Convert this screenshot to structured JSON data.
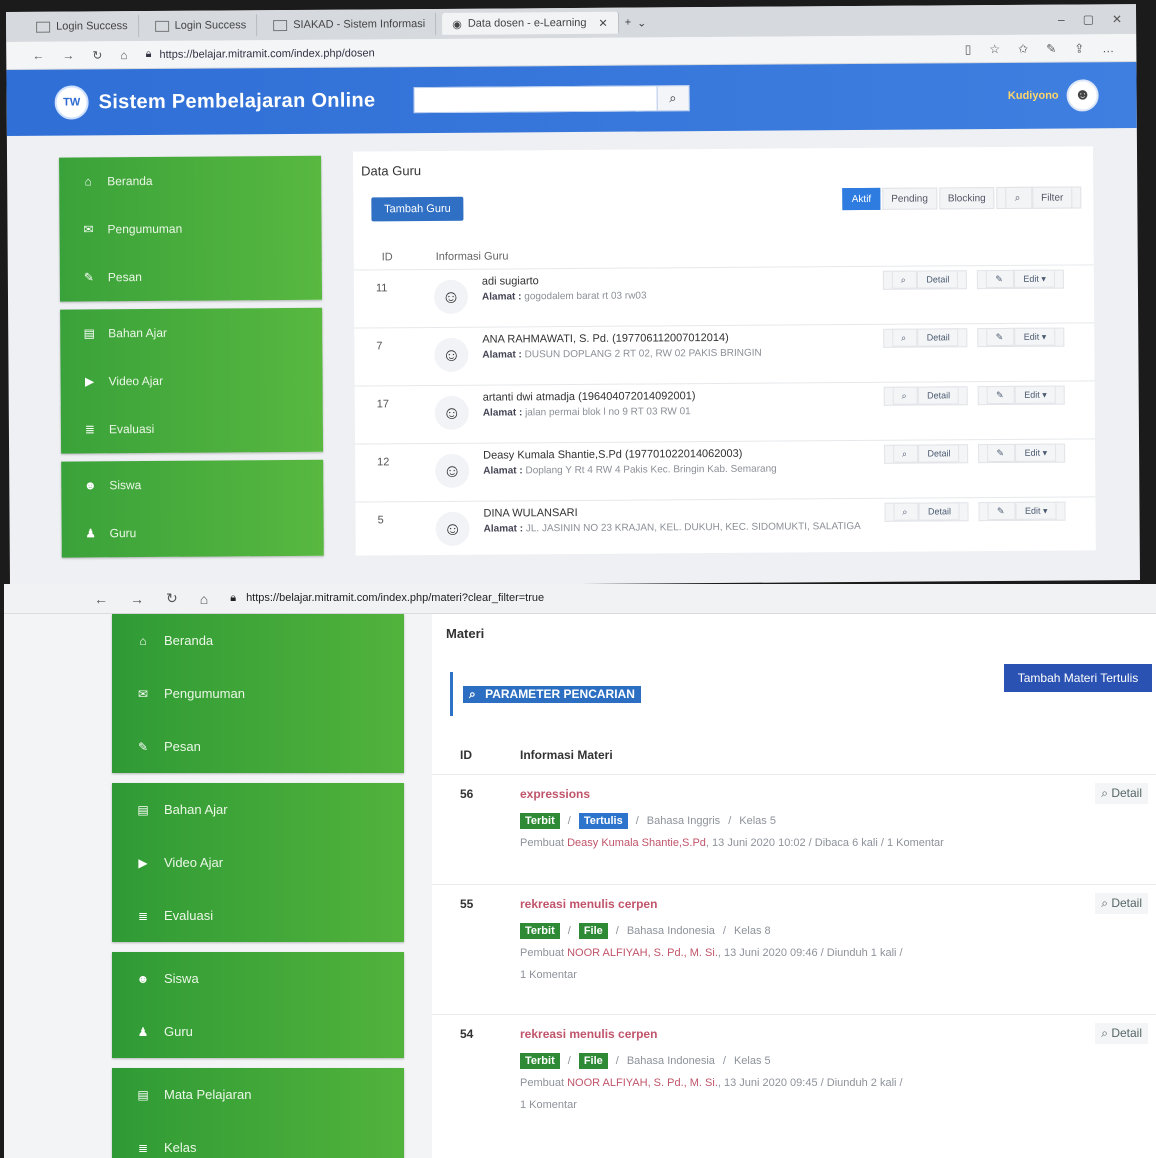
{
  "top": {
    "tabs": [
      {
        "label": "Login Success"
      },
      {
        "label": "Login Success"
      },
      {
        "label": "SIAKAD - Sistem Informasi"
      },
      {
        "label": "Data dosen - e-Learning"
      }
    ],
    "url": "https://belajar.mitramit.com/index.php/dosen",
    "app_title": "Sistem Pembelajaran Online",
    "user_name": "Kudiyono",
    "sidebar": {
      "groups": [
        [
          {
            "icon": "home-icon",
            "glyph": "⌂",
            "label": "Beranda"
          },
          {
            "icon": "megaphone-icon",
            "glyph": "✉",
            "label": "Pengumuman"
          },
          {
            "icon": "chat-icon",
            "glyph": "✎",
            "label": "Pesan"
          }
        ],
        [
          {
            "icon": "book-icon",
            "glyph": "▤",
            "label": "Bahan Ajar"
          },
          {
            "icon": "video-icon",
            "glyph": "▶",
            "label": "Video Ajar"
          },
          {
            "icon": "list-icon",
            "glyph": "≣",
            "label": "Evaluasi"
          }
        ],
        [
          {
            "icon": "users-icon",
            "glyph": "☻",
            "label": "Siswa"
          },
          {
            "icon": "user-icon",
            "glyph": "♟",
            "label": "Guru"
          }
        ]
      ]
    },
    "main": {
      "title": "Data Guru",
      "add_button": "Tambah Guru",
      "filters": [
        "Aktif",
        "Pending",
        "Blocking",
        "Filter"
      ],
      "headers": {
        "id": "ID",
        "info": "Informasi Guru"
      },
      "address_label": "Alamat :",
      "detail_label": "Detail",
      "edit_label": "Edit ▾",
      "rows": [
        {
          "id": "11",
          "name": "adi sugiarto",
          "address": "gogodalem barat rt 03 rw03"
        },
        {
          "id": "7",
          "name": "ANA RAHMAWATI, S. Pd. (197706112007012014)",
          "address": "DUSUN DOPLANG 2 RT 02, RW 02 PAKIS BRINGIN"
        },
        {
          "id": "17",
          "name": "artanti dwi atmadja (196404072014092001)",
          "address": "jalan permai blok l no 9 RT 03 RW 01"
        },
        {
          "id": "12",
          "name": "Deasy Kumala Shantie,S.Pd (197701022014062003)",
          "address": "Doplang Y Rt 4 RW 4 Pakis Kec. Bringin Kab. Semarang"
        },
        {
          "id": "5",
          "name": "DINA WULANSARI",
          "address": "JL. JASININ NO 23 KRAJAN, KEL. DUKUH, KEC. SIDOMUKTI, SALATIGA"
        }
      ]
    }
  },
  "bottom": {
    "url": "https://belajar.mitramit.com/index.php/materi?clear_filter=true",
    "sidebar": {
      "groups": [
        [
          {
            "icon": "home-icon",
            "glyph": "⌂",
            "label": "Beranda"
          },
          {
            "icon": "megaphone-icon",
            "glyph": "✉",
            "label": "Pengumuman"
          },
          {
            "icon": "chat-icon",
            "glyph": "✎",
            "label": "Pesan"
          }
        ],
        [
          {
            "icon": "book-icon",
            "glyph": "▤",
            "label": "Bahan Ajar"
          },
          {
            "icon": "video-icon",
            "glyph": "▶",
            "label": "Video Ajar"
          },
          {
            "icon": "list-icon",
            "glyph": "≣",
            "label": "Evaluasi"
          }
        ],
        [
          {
            "icon": "users-icon",
            "glyph": "☻",
            "label": "Siswa"
          },
          {
            "icon": "user-icon",
            "glyph": "♟",
            "label": "Guru"
          }
        ],
        [
          {
            "icon": "book-icon",
            "glyph": "▤",
            "label": "Mata Pelajaran"
          },
          {
            "icon": "list-icon",
            "glyph": "≣",
            "label": "Kelas"
          }
        ]
      ]
    },
    "main": {
      "title": "Materi",
      "param_label": "PARAMETER PENCARIAN",
      "add_button": "Tambah Materi Tertulis",
      "headers": {
        "id": "ID",
        "info": "Informasi Materi"
      },
      "detail_label": "Detail",
      "rows": [
        {
          "id": "56",
          "title": "expressions",
          "status": "Terbit",
          "type": "Tertulis",
          "subject": "Bahasa Inggris",
          "class": "Kelas 5",
          "author_prefix": "Pembuat",
          "author": "Deasy Kumala Shantie,S.Pd",
          "date": "13 Juni 2020 10:02",
          "stat": "Dibaca 6 kali",
          "comment": "1 Komentar"
        },
        {
          "id": "55",
          "title": "rekreasi menulis cerpen",
          "status": "Terbit",
          "type": "File",
          "subject": "Bahasa Indonesia",
          "class": "Kelas 8",
          "author_prefix": "Pembuat",
          "author": "NOOR ALFIYAH, S. Pd., M. Si.",
          "date": "13 Juni 2020 09:46",
          "stat": "Diunduh 1 kali",
          "comment": "1 Komentar"
        },
        {
          "id": "54",
          "title": "rekreasi menulis cerpen",
          "status": "Terbit",
          "type": "File",
          "subject": "Bahasa Indonesia",
          "class": "Kelas 5",
          "author_prefix": "Pembuat",
          "author": "NOOR ALFIYAH, S. Pd., M. Si.",
          "date": "13 Juni 2020 09:45",
          "stat": "Diunduh 2 kali",
          "comment": "1 Komentar"
        }
      ]
    }
  }
}
